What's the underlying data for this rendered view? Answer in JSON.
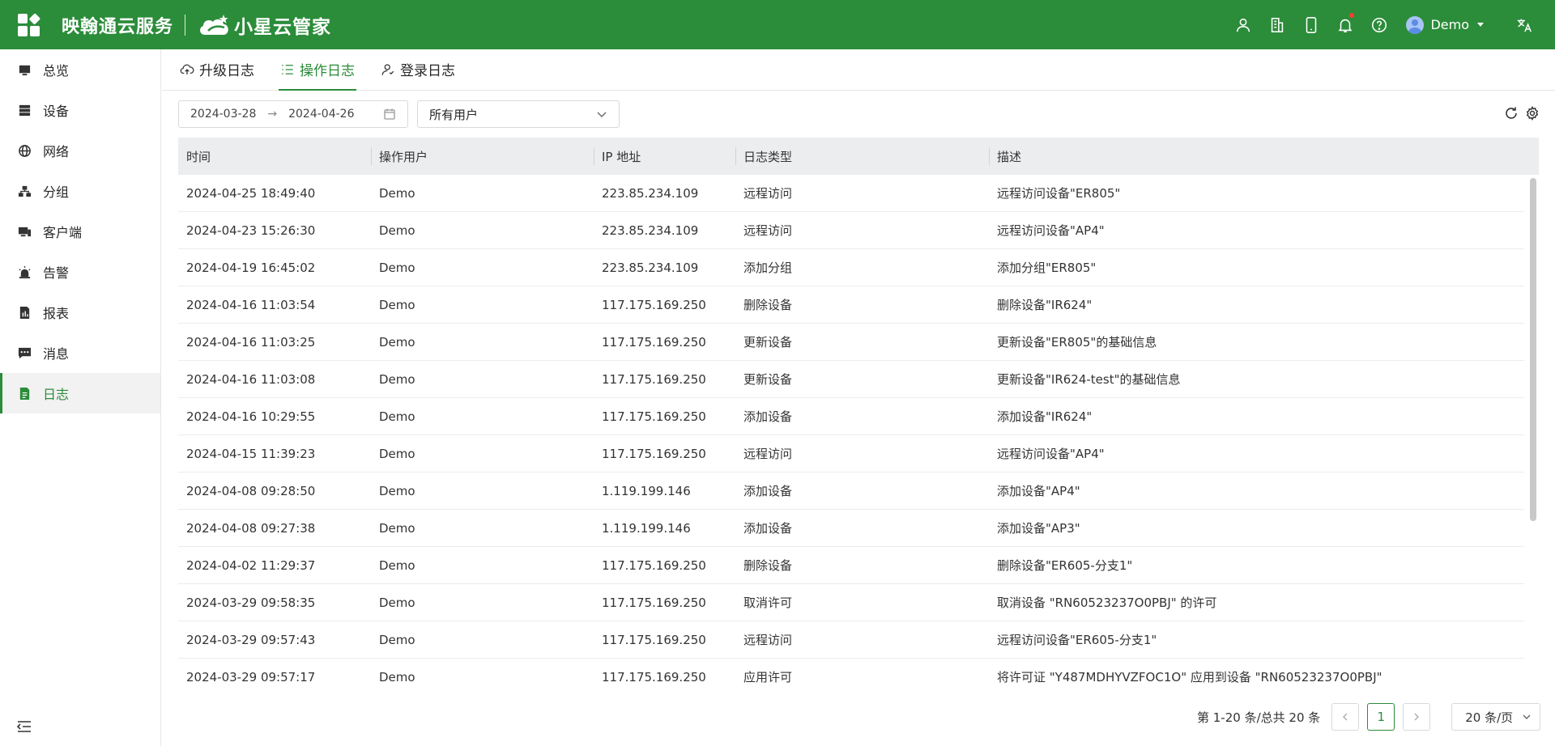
{
  "header": {
    "brand": "映翰通云服务",
    "product": "小星云管家",
    "user": "Demo",
    "lang_icon": "translate-icon",
    "colors": {
      "primary": "#2b8c3a",
      "notify": "#ff3b30"
    }
  },
  "sidebar": {
    "items": [
      {
        "label": "总览",
        "icon": "overview-icon"
      },
      {
        "label": "设备",
        "icon": "device-icon"
      },
      {
        "label": "网络",
        "icon": "globe-icon"
      },
      {
        "label": "分组",
        "icon": "group-icon"
      },
      {
        "label": "客户端",
        "icon": "client-icon"
      },
      {
        "label": "告警",
        "icon": "alarm-icon"
      },
      {
        "label": "报表",
        "icon": "report-icon"
      },
      {
        "label": "消息",
        "icon": "message-icon"
      },
      {
        "label": "日志",
        "icon": "log-icon",
        "active": true
      }
    ]
  },
  "tabs": [
    {
      "label": "升级日志",
      "icon": "cloud-upload-icon"
    },
    {
      "label": "操作日志",
      "icon": "list-icon",
      "active": true
    },
    {
      "label": "登录日志",
      "icon": "user-icon"
    }
  ],
  "filters": {
    "date_start": "2024-03-28",
    "date_arrow": "→",
    "date_end": "2024-04-26",
    "user_select": "所有用户"
  },
  "table": {
    "columns": [
      "时间",
      "操作用户",
      "IP 地址",
      "日志类型",
      "描述"
    ],
    "rows": [
      [
        "2024-04-25 18:49:40",
        "Demo",
        "223.85.234.109",
        "远程访问",
        "远程访问设备\"ER805\""
      ],
      [
        "2024-04-23 15:26:30",
        "Demo",
        "223.85.234.109",
        "远程访问",
        "远程访问设备\"AP4\""
      ],
      [
        "2024-04-19 16:45:02",
        "Demo",
        "223.85.234.109",
        "添加分组",
        "添加分组\"ER805\""
      ],
      [
        "2024-04-16 11:03:54",
        "Demo",
        "117.175.169.250",
        "删除设备",
        "删除设备\"IR624\""
      ],
      [
        "2024-04-16 11:03:25",
        "Demo",
        "117.175.169.250",
        "更新设备",
        "更新设备\"ER805\"的基础信息"
      ],
      [
        "2024-04-16 11:03:08",
        "Demo",
        "117.175.169.250",
        "更新设备",
        "更新设备\"IR624-test\"的基础信息"
      ],
      [
        "2024-04-16 10:29:55",
        "Demo",
        "117.175.169.250",
        "添加设备",
        "添加设备\"IR624\""
      ],
      [
        "2024-04-15 11:39:23",
        "Demo",
        "117.175.169.250",
        "远程访问",
        "远程访问设备\"AP4\""
      ],
      [
        "2024-04-08 09:28:50",
        "Demo",
        "1.119.199.146",
        "添加设备",
        "添加设备\"AP4\""
      ],
      [
        "2024-04-08 09:27:38",
        "Demo",
        "1.119.199.146",
        "添加设备",
        "添加设备\"AP3\""
      ],
      [
        "2024-04-02 11:29:37",
        "Demo",
        "117.175.169.250",
        "删除设备",
        "删除设备\"ER605-分支1\""
      ],
      [
        "2024-03-29 09:58:35",
        "Demo",
        "117.175.169.250",
        "取消许可",
        "取消设备 \"RN60523237O0PBJ\" 的许可"
      ],
      [
        "2024-03-29 09:57:43",
        "Demo",
        "117.175.169.250",
        "远程访问",
        "远程访问设备\"ER605-分支1\""
      ],
      [
        "2024-03-29 09:57:17",
        "Demo",
        "117.175.169.250",
        "应用许可",
        "将许可证 \"Y487MDHYVZFOC1O\" 应用到设备 \"RN60523237O0PBJ\""
      ]
    ]
  },
  "pagination": {
    "total_text": "第 1-20 条/总共 20 条",
    "current_page": "1",
    "page_size": "20 条/页"
  }
}
